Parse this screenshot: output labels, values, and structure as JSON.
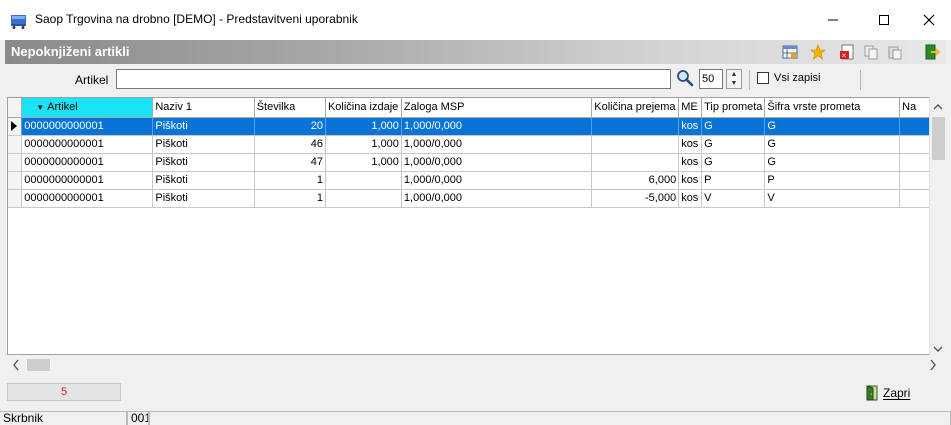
{
  "window": {
    "title": "Saop Trgovina na drobno [DEMO] - Predstavitveni uporabnik",
    "minimize_glyph": "—",
    "maximize_glyph": "☐",
    "close_glyph": "✕"
  },
  "header": {
    "title": "Nepoknjiženi artikli",
    "toolbar_icons": [
      "table-settings-icon",
      "star-icon",
      "pdf-export-icon",
      "copy-icon",
      "paste-icon",
      "exit-icon"
    ]
  },
  "filter": {
    "label": "Artikel",
    "value": "",
    "record_count_value": "50",
    "all_records_label": "Vsi zapisi",
    "all_records_checked": false
  },
  "grid": {
    "columns": [
      {
        "label": "Artikel",
        "sorted": "desc"
      },
      {
        "label": "Naziv 1"
      },
      {
        "label": "Številka"
      },
      {
        "label": "Količina izdaje"
      },
      {
        "label": "Zaloga MSP"
      },
      {
        "label": "Količina prejema"
      },
      {
        "label": "ME"
      },
      {
        "label": "Tip prometa"
      },
      {
        "label": "Šifra vrste prometa"
      },
      {
        "label": "Na"
      }
    ],
    "rows": [
      {
        "artikel": "0000000000001",
        "naziv": "Piškoti",
        "stevilka": "20",
        "kol_izdaje": "1,000",
        "zaloga": "1,000/0,000",
        "kol_prejema": "",
        "me": "kos",
        "tip": "G",
        "sifra": "G",
        "selected": true
      },
      {
        "artikel": "0000000000001",
        "naziv": "Piškoti",
        "stevilka": "46",
        "kol_izdaje": "1,000",
        "zaloga": "1,000/0,000",
        "kol_prejema": "",
        "me": "kos",
        "tip": "G",
        "sifra": "G"
      },
      {
        "artikel": "0000000000001",
        "naziv": "Piškoti",
        "stevilka": "47",
        "kol_izdaje": "1,000",
        "zaloga": "1,000/0,000",
        "kol_prejema": "",
        "me": "kos",
        "tip": "G",
        "sifra": "G"
      },
      {
        "artikel": "0000000000001",
        "naziv": "Piškoti",
        "stevilka": "1",
        "kol_izdaje": "",
        "zaloga": "1,000/0,000",
        "kol_prejema": "6,000",
        "me": "kos",
        "tip": "P",
        "sifra": "P"
      },
      {
        "artikel": "0000000000001",
        "naziv": "Piškoti",
        "stevilka": "1",
        "kol_izdaje": "",
        "zaloga": "1,000/0,000",
        "kol_prejema": "-5,000",
        "me": "kos",
        "tip": "V",
        "sifra": "V"
      }
    ]
  },
  "footer": {
    "row_count": "5",
    "close_label": "Zapri",
    "status_user_label": "Skrbnik",
    "status_code": "001"
  },
  "colors": {
    "selection": "#0a74d6",
    "sorted_header": "#19e3f5",
    "count_text": "#e02020"
  }
}
